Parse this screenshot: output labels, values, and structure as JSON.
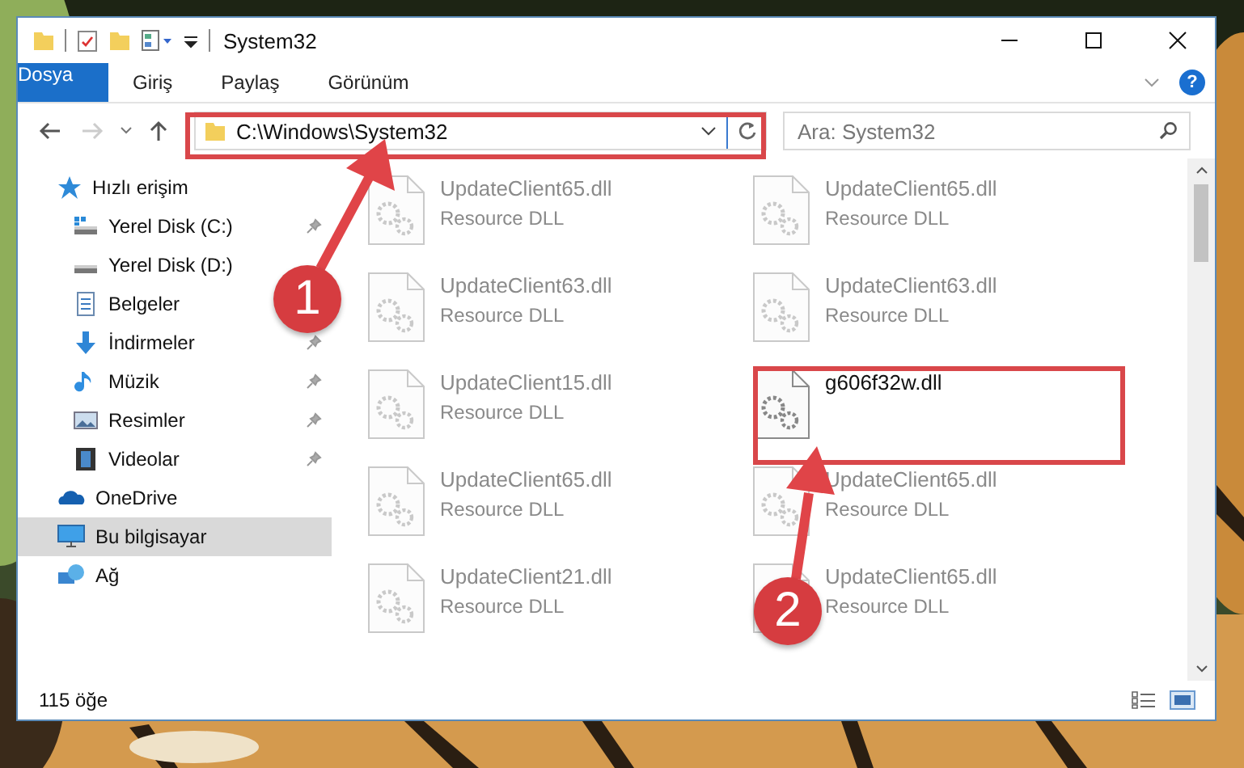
{
  "window": {
    "title": "System32"
  },
  "ribbon": {
    "tabs": [
      {
        "label": "Dosya",
        "kind": "file"
      },
      {
        "label": "Giriş",
        "kind": "tab"
      },
      {
        "label": "Paylaş",
        "kind": "tab"
      },
      {
        "label": "Görünüm",
        "kind": "tab"
      }
    ],
    "help": "?"
  },
  "address_bar": {
    "path": "C:\\Windows\\System32"
  },
  "search": {
    "placeholder": "Ara: System32"
  },
  "sidebar": {
    "items": [
      {
        "label": "Hızlı erişim",
        "kind": "quick",
        "selected": false,
        "children": [
          {
            "label": "Yerel Disk (C:)",
            "kind": "drive-c",
            "pinned": true
          },
          {
            "label": "Yerel Disk (D:)",
            "kind": "drive",
            "pinned": false
          },
          {
            "label": "Belgeler",
            "kind": "documents",
            "pinned": false
          },
          {
            "label": "İndirmeler",
            "kind": "downloads",
            "pinned": true
          },
          {
            "label": "Müzik",
            "kind": "music",
            "pinned": true
          },
          {
            "label": "Resimler",
            "kind": "pictures",
            "pinned": true
          },
          {
            "label": "Videolar",
            "kind": "videos",
            "pinned": true
          }
        ]
      },
      {
        "label": "OneDrive",
        "kind": "cloud",
        "selected": false
      },
      {
        "label": "Bu bilgisayar",
        "kind": "computer",
        "selected": true
      },
      {
        "label": "Ağ",
        "kind": "network",
        "selected": false
      }
    ]
  },
  "files": [
    {
      "name": "UpdateClient65.dll",
      "type": "Resource DLL",
      "highlighted": false
    },
    {
      "name": "UpdateClient65.dll",
      "type": "Resource DLL",
      "highlighted": false
    },
    {
      "name": "UpdateClient63.dll",
      "type": "Resource DLL",
      "highlighted": false
    },
    {
      "name": "UpdateClient63.dll",
      "type": "Resource DLL",
      "highlighted": false
    },
    {
      "name": "UpdateClient15.dll",
      "type": "Resource DLL",
      "highlighted": false
    },
    {
      "name": "g606f32w.dll",
      "highlighted": true
    },
    {
      "name": "UpdateClient65.dll",
      "type": "Resource DLL",
      "highlighted": false
    },
    {
      "name": "UpdateClient65.dll",
      "type": "Resource DLL",
      "highlighted": false
    },
    {
      "name": "UpdateClient21.dll",
      "type": "Resource DLL",
      "highlighted": false
    },
    {
      "name": "UpdateClient65.dll",
      "type": "Resource DLL",
      "highlighted": false
    }
  ],
  "status_bar": {
    "count": "115 öğe"
  },
  "annotations": [
    {
      "number": "1"
    },
    {
      "number": "2"
    }
  ]
}
